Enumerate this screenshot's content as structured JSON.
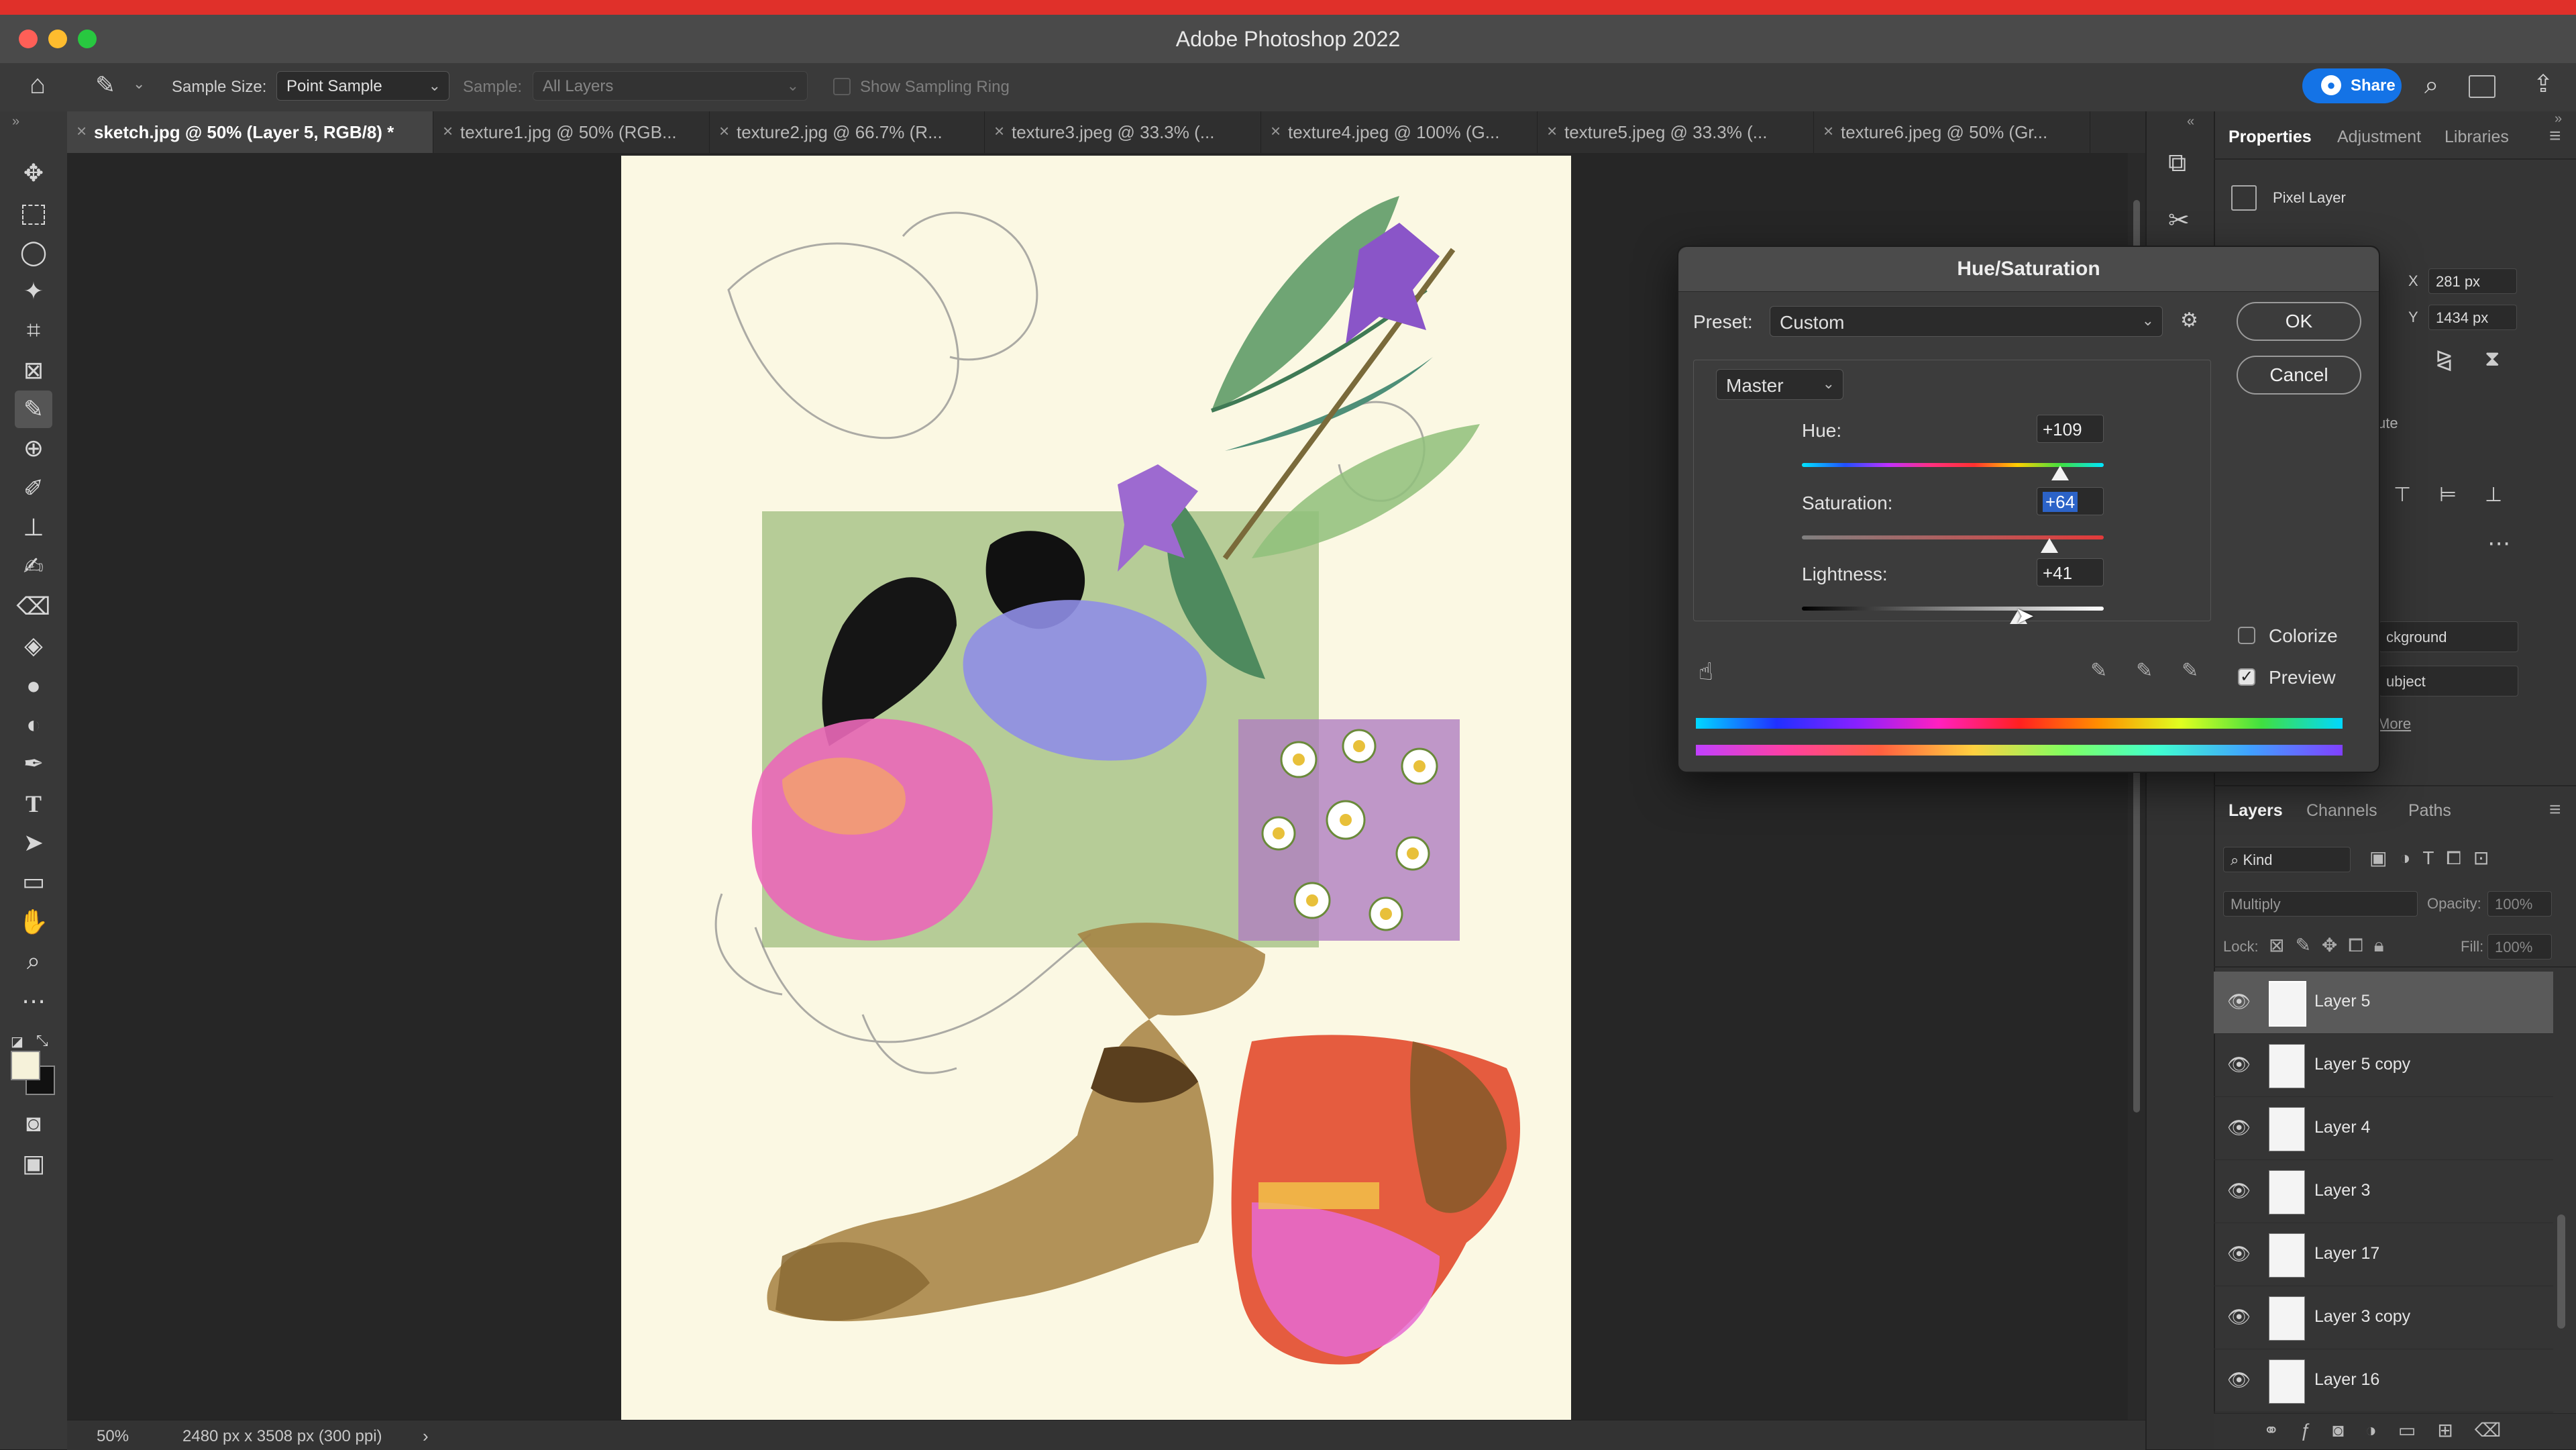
{
  "app": {
    "title": "Adobe Photoshop 2022"
  },
  "options_bar": {
    "sample_size_label": "Sample Size:",
    "sample_size_value": "Point Sample",
    "sample_label": "Sample:",
    "sample_value": "All Layers",
    "show_sampling_ring_label": "Show Sampling Ring",
    "share_label": "Share"
  },
  "tabs": [
    {
      "label": "sketch.jpg @ 50% (Layer 5, RGB/8) *"
    },
    {
      "label": "texture1.jpg @ 50% (RGB..."
    },
    {
      "label": "texture2.jpg @ 66.7% (R..."
    },
    {
      "label": "texture3.jpeg @ 33.3% (..."
    },
    {
      "label": "texture4.jpeg @ 100% (G..."
    },
    {
      "label": "texture5.jpeg @ 33.3% (..."
    },
    {
      "label": "texture6.jpeg @ 50% (Gr..."
    }
  ],
  "status_bar": {
    "zoom": "50%",
    "doc_info": "2480 px x 3508 px (300 ppi)",
    "arrow": "›"
  },
  "properties_panel": {
    "tabs": [
      "Properties",
      "Adjustment",
      "Libraries"
    ],
    "layer_type": "Pixel Layer",
    "x_label": "X",
    "x_value": "281 px",
    "y_label": "Y",
    "y_value": "1434 px",
    "partial_text_1": "ute",
    "partial_text_2": "ckground",
    "partial_text_3": "ubject",
    "partial_text_4": "More"
  },
  "layers_panel": {
    "tabs": [
      "Layers",
      "Channels",
      "Paths"
    ],
    "kind_placeholder": "Kind",
    "blend_mode": "Multiply",
    "opacity_label": "Opacity:",
    "opacity_value": "100%",
    "lock_label": "Lock:",
    "fill_label": "Fill:",
    "fill_value": "100%",
    "layers": [
      {
        "name": "Layer 5",
        "selected": true
      },
      {
        "name": "Layer 5 copy"
      },
      {
        "name": "Layer 4"
      },
      {
        "name": "Layer 3"
      },
      {
        "name": "Layer 17"
      },
      {
        "name": "Layer 3 copy"
      },
      {
        "name": "Layer 16"
      }
    ]
  },
  "hue_saturation_dialog": {
    "title": "Hue/Saturation",
    "preset_label": "Preset:",
    "preset_value": "Custom",
    "ok_label": "OK",
    "cancel_label": "Cancel",
    "channel": "Master",
    "hue_label": "Hue:",
    "hue_value": "+109",
    "saturation_label": "Saturation:",
    "saturation_value": "+64",
    "lightness_label": "Lightness:",
    "lightness_value": "+41",
    "colorize_label": "Colorize",
    "colorize_checked": false,
    "preview_label": "Preview",
    "preview_checked": true
  },
  "colors": {
    "accent": "#1473e6",
    "titlebar_stripe": "#e0302a"
  }
}
